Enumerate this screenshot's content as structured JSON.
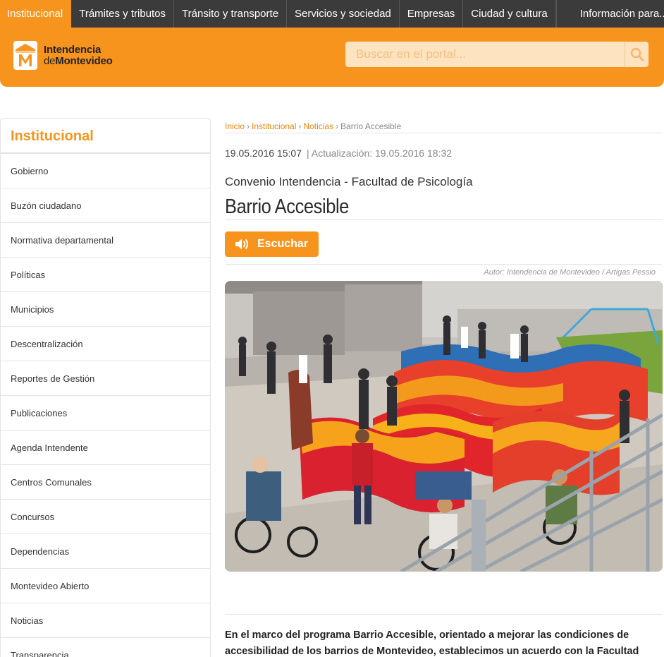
{
  "topnav": {
    "items": [
      {
        "label": "Institucional"
      },
      {
        "label": "Trámites y tributos"
      },
      {
        "label": "Tránsito y transporte"
      },
      {
        "label": "Servicios y sociedad"
      },
      {
        "label": "Empresas"
      },
      {
        "label": "Ciudad y cultura"
      }
    ],
    "info_label": "Información para..."
  },
  "header": {
    "logo_line1": "Intendencia",
    "logo_line2_a": "de",
    "logo_line2_b": "Montevideo",
    "search_placeholder": "Buscar en el portal..."
  },
  "sidebar": {
    "title": "Institucional",
    "items": [
      {
        "label": "Gobierno"
      },
      {
        "label": "Buzón ciudadano"
      },
      {
        "label": "Normativa departamental"
      },
      {
        "label": "Políticas"
      },
      {
        "label": "Municipios"
      },
      {
        "label": "Descentralización"
      },
      {
        "label": "Reportes de Gestión"
      },
      {
        "label": "Publicaciones"
      },
      {
        "label": "Agenda Intendente"
      },
      {
        "label": "Centros Comunales"
      },
      {
        "label": "Concursos"
      },
      {
        "label": "Dependencias"
      },
      {
        "label": "Montevideo Abierto"
      },
      {
        "label": "Noticias"
      },
      {
        "label": "Transparencia"
      }
    ]
  },
  "breadcrumb": {
    "items": [
      {
        "label": "Inicio"
      },
      {
        "label": "Institucional"
      },
      {
        "label": "Noticias"
      }
    ],
    "current": "Barrio Accesible",
    "separator": "›"
  },
  "article": {
    "published": "19.05.2016 15:07",
    "updated": "| Actualización: 19.05.2016 18:32",
    "subtitle": "Convenio Intendencia - Facultad de Psicología",
    "title": "Barrio Accesible",
    "listen_label": "Escuchar",
    "photo_credit": "Autor: Intendencia de Montevideo / Artigas Pessio",
    "lead": "En el marco del programa Barrio Accesible, orientado a mejorar las condiciones de accesibilidad de los barrios de Montevideo, establecimos un acuerdo con la Facultad"
  },
  "colors": {
    "accent": "#f7941d",
    "topnav_bg": "#3b3b3b",
    "search_bg": "#fde3c0"
  }
}
